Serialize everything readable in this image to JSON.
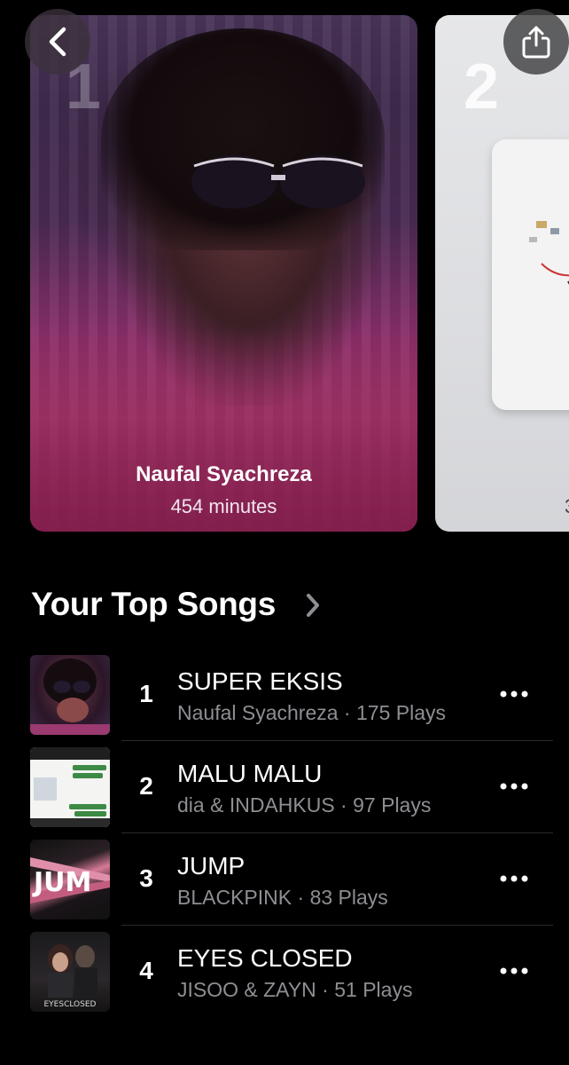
{
  "featured": [
    {
      "rank": "1",
      "name": "Naufal Syachreza",
      "minutes": "454 minutes"
    },
    {
      "rank": "2",
      "peek_text": "3"
    }
  ],
  "section": {
    "title": "Your Top Songs"
  },
  "songs": [
    {
      "rank": "1",
      "title": "SUPER EKSIS",
      "artist": "Naufal Syachreza",
      "plays": "175 Plays"
    },
    {
      "rank": "2",
      "title": "MALU MALU",
      "artist": "dia & INDAHKUS",
      "plays": "97 Plays"
    },
    {
      "rank": "3",
      "title": "JUMP",
      "artist": "BLACKPINK",
      "plays": "83 Plays"
    },
    {
      "rank": "4",
      "title": "EYES CLOSED",
      "artist": "JISOO & ZAYN",
      "plays": "51 Plays"
    }
  ],
  "separator": " · ",
  "art_text": {
    "jump": "JUM",
    "eyes_closed": "EYESCLOSED"
  },
  "icons": {
    "back": "chevron-left-icon",
    "share": "share-icon",
    "section": "chevron-right-icon",
    "row_more": "ellipsis-icon"
  }
}
